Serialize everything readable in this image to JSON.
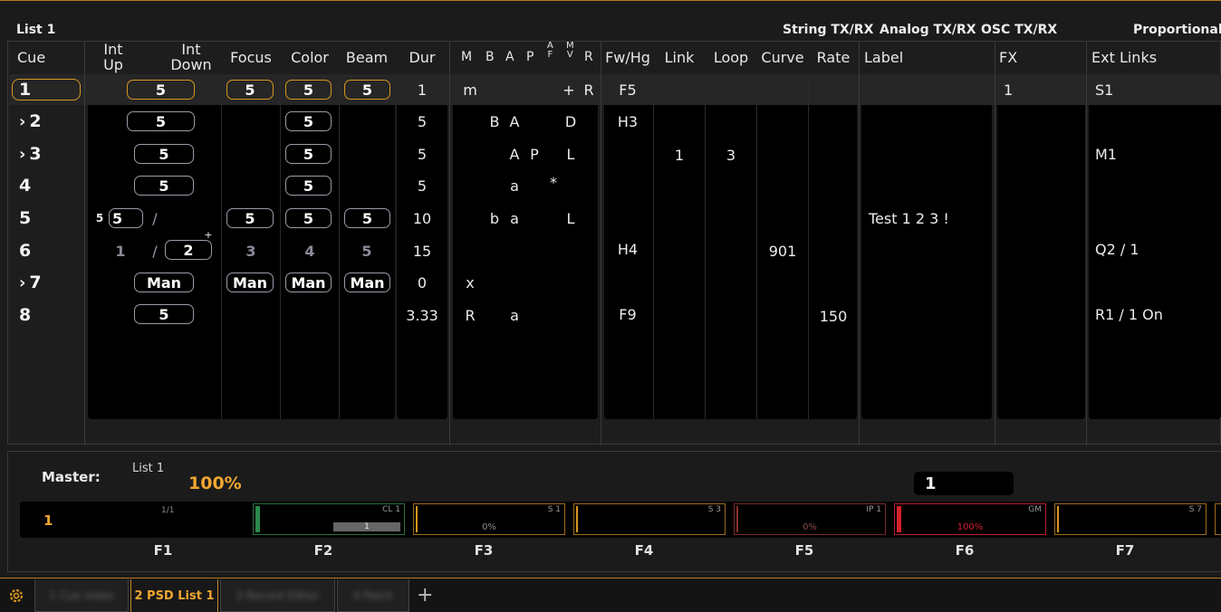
{
  "header": {
    "list_title": "List 1",
    "string_txrx": "String TX/RX",
    "analog_txrx": "Analog TX/RX",
    "osc_txrx": "OSC TX/RX",
    "mode": "Proportional"
  },
  "columns": {
    "cue": "Cue",
    "int_up_1": "Int",
    "int_up_2": "Up",
    "int_down_1": "Int",
    "int_down_2": "Down",
    "focus": "Focus",
    "color": "Color",
    "beam": "Beam",
    "dur": "Dur",
    "m": "M",
    "b": "B",
    "a": "A",
    "p": "P",
    "af_a": "A",
    "af_f": "F",
    "mv_m": "M",
    "mv_v": "V",
    "r": "R",
    "fwhg": "Fw/Hg",
    "link": "Link",
    "loop": "Loop",
    "curve": "Curve",
    "rate": "Rate",
    "label": "Label",
    "fx": "FX",
    "ext_links": "Ext Links"
  },
  "cues": [
    {
      "num": "1",
      "intup": "5",
      "focus": "5",
      "color": "5",
      "beam": "5",
      "dur": "1",
      "m": "m",
      "plus": "+",
      "r": "R",
      "fwhg": "F5",
      "fx": "1",
      "ext": "S1"
    },
    {
      "num": "2",
      "intup": "5",
      "color": "5",
      "dur": "5",
      "b": "B",
      "a": "A",
      "d": "D",
      "fwhg": "H3"
    },
    {
      "num": "3",
      "intup": "5",
      "color": "5",
      "dur": "5",
      "a": "A",
      "p": "P",
      "l": "L",
      "link": "1",
      "loop": "3",
      "ext": "M1"
    },
    {
      "num": "4",
      "intup": "5",
      "color": "5",
      "dur": "5",
      "a": "a",
      "star": "*"
    },
    {
      "num": "5",
      "intdelay": "5",
      "intup": "5",
      "slash": "/",
      "focus": "5",
      "color": "5",
      "beam": "5",
      "dur": "10",
      "b": "b",
      "a": "a",
      "l": "L",
      "label": "Test 1 2 3 !"
    },
    {
      "num": "6",
      "intup": "1",
      "slash": "/",
      "intdown": "2",
      "plus": "+",
      "focus": "3",
      "color": "4",
      "beam": "5",
      "dur": "15",
      "fwhg": "H4",
      "curve": "901",
      "ext": "Q2 / 1"
    },
    {
      "num": "7",
      "intup": "Man",
      "focus": "Man",
      "color": "Man",
      "beam": "Man",
      "dur": "0",
      "m": "x"
    },
    {
      "num": "8",
      "intup": "5",
      "dur": "3.33",
      "m": "R",
      "a": "a",
      "fwhg": "F9",
      "rate": "150",
      "ext": "R1 / 1 On"
    }
  ],
  "master": {
    "label": "Master:",
    "list": "List 1",
    "percent": "100%",
    "current_cue": "1"
  },
  "faders": [
    {
      "name": "1/1",
      "value": "1",
      "key": "F1",
      "fill": 0
    },
    {
      "name": "CL 1",
      "value": "1",
      "key": "F2",
      "fill": 0
    },
    {
      "name": "S 1",
      "value": "0%",
      "key": "F3",
      "fill": 0
    },
    {
      "name": "S 3",
      "value": "",
      "key": "F4",
      "fill": 0
    },
    {
      "name": "IP 1",
      "value": "0%",
      "key": "F5",
      "fill": 0
    },
    {
      "name": "GM",
      "value": "100%",
      "key": "F6",
      "fill": 1
    },
    {
      "name": "S 7",
      "value": "",
      "key": "F7",
      "fill": 0
    }
  ],
  "tabs": [
    {
      "label": "1 Cue Index"
    },
    {
      "label": "2 PSD List 1"
    },
    {
      "label": "3 Record Editor"
    },
    {
      "label": "4 Patch"
    }
  ],
  "colors": {
    "accent": "#d8961f",
    "green": "#2a8a4a",
    "red": "#d4202c"
  },
  "icons": {
    "settings": "gear-icon",
    "add_tab": "plus-icon"
  }
}
